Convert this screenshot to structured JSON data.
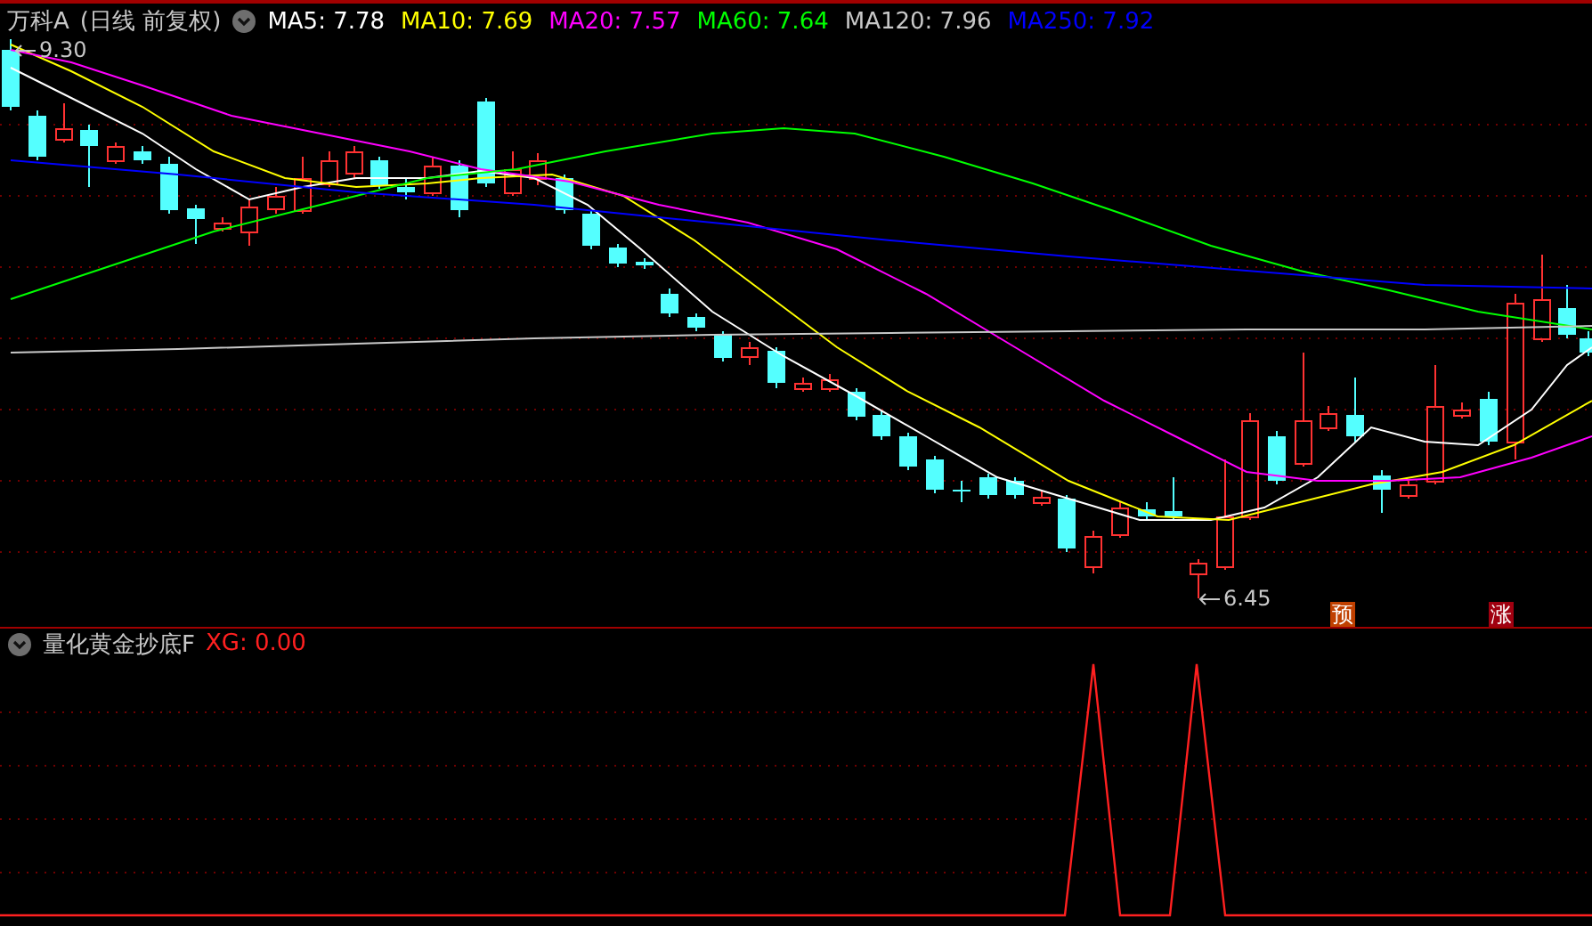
{
  "header": {
    "stock_name": "万科A",
    "period": "(日线 前复权)",
    "ma_lines": [
      {
        "label": "MA5: 7.78",
        "color": "#ffffff"
      },
      {
        "label": "MA10: 7.69",
        "color": "#ffff00"
      },
      {
        "label": "MA20: 7.57",
        "color": "#ff00ff"
      },
      {
        "label": "MA60: 7.64",
        "color": "#00ff00"
      },
      {
        "label": "MA120: 7.96",
        "color": "#c8c8c8"
      },
      {
        "label": "MA250: 7.92",
        "color": "#0000ff"
      }
    ]
  },
  "price_chart": {
    "high_label": "9.30",
    "low_label": "6.45",
    "markers": [
      {
        "text": "预",
        "color": "#c04000"
      },
      {
        "text": "涨",
        "color": "#a00010"
      }
    ]
  },
  "indicator": {
    "name": "量化黄金抄底F",
    "reading": "XG: 0.00"
  }
}
